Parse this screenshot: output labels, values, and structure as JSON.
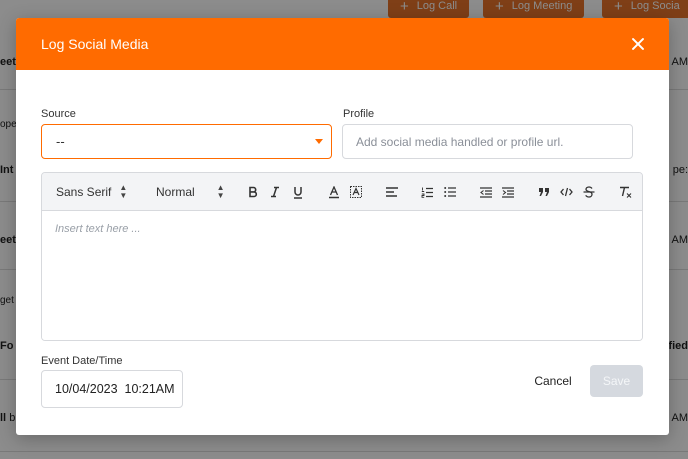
{
  "background": {
    "actions": [
      {
        "label": "Log Call",
        "icon": "plus-icon"
      },
      {
        "label": "Log Meeting",
        "icon": "plus-icon"
      },
      {
        "label": "Log Socia",
        "icon": "plus-icon"
      }
    ],
    "fragments": {
      "r1_left": "eeti",
      "r1_right": "3 AM",
      "r1_sub": "ope",
      "r2_left": "Int",
      "r2_right": "pe: ",
      "r3_left": "eeti",
      "r3_right": "3 AM",
      "r3_sub": "get",
      "r4_left": "Fo",
      "r4_right": "ified",
      "r5_left": "ll",
      "r5_left2": "b",
      "r5_right": "2 AM"
    },
    "overlay_color": "#000000"
  },
  "modal": {
    "title": "Log Social Media",
    "close_icon": "close-icon",
    "header_color": "#ff6b00",
    "source": {
      "label": "Source",
      "value": "--",
      "icon": "caret-down-icon"
    },
    "profile": {
      "label": "Profile",
      "placeholder": "Add social media handled or profile url.",
      "value": ""
    },
    "editor": {
      "font_picker": "Sans Serif",
      "size_picker": "Normal",
      "toolbar_icons": [
        "bold-icon",
        "italic-icon",
        "underline-icon",
        "text-color-icon",
        "background-color-icon",
        "align-icon",
        "ordered-list-icon",
        "bullet-list-icon",
        "outdent-icon",
        "indent-icon",
        "blockquote-icon",
        "code-icon",
        "strike-icon",
        "clear-format-icon"
      ],
      "placeholder": "Insert text here ..."
    },
    "event_date": {
      "label": "Event Date/Time",
      "value": "10/04/2023  10:21AM"
    },
    "cancel_label": "Cancel",
    "save_label": "Save",
    "save_disabled_color": "#d5d9df"
  }
}
